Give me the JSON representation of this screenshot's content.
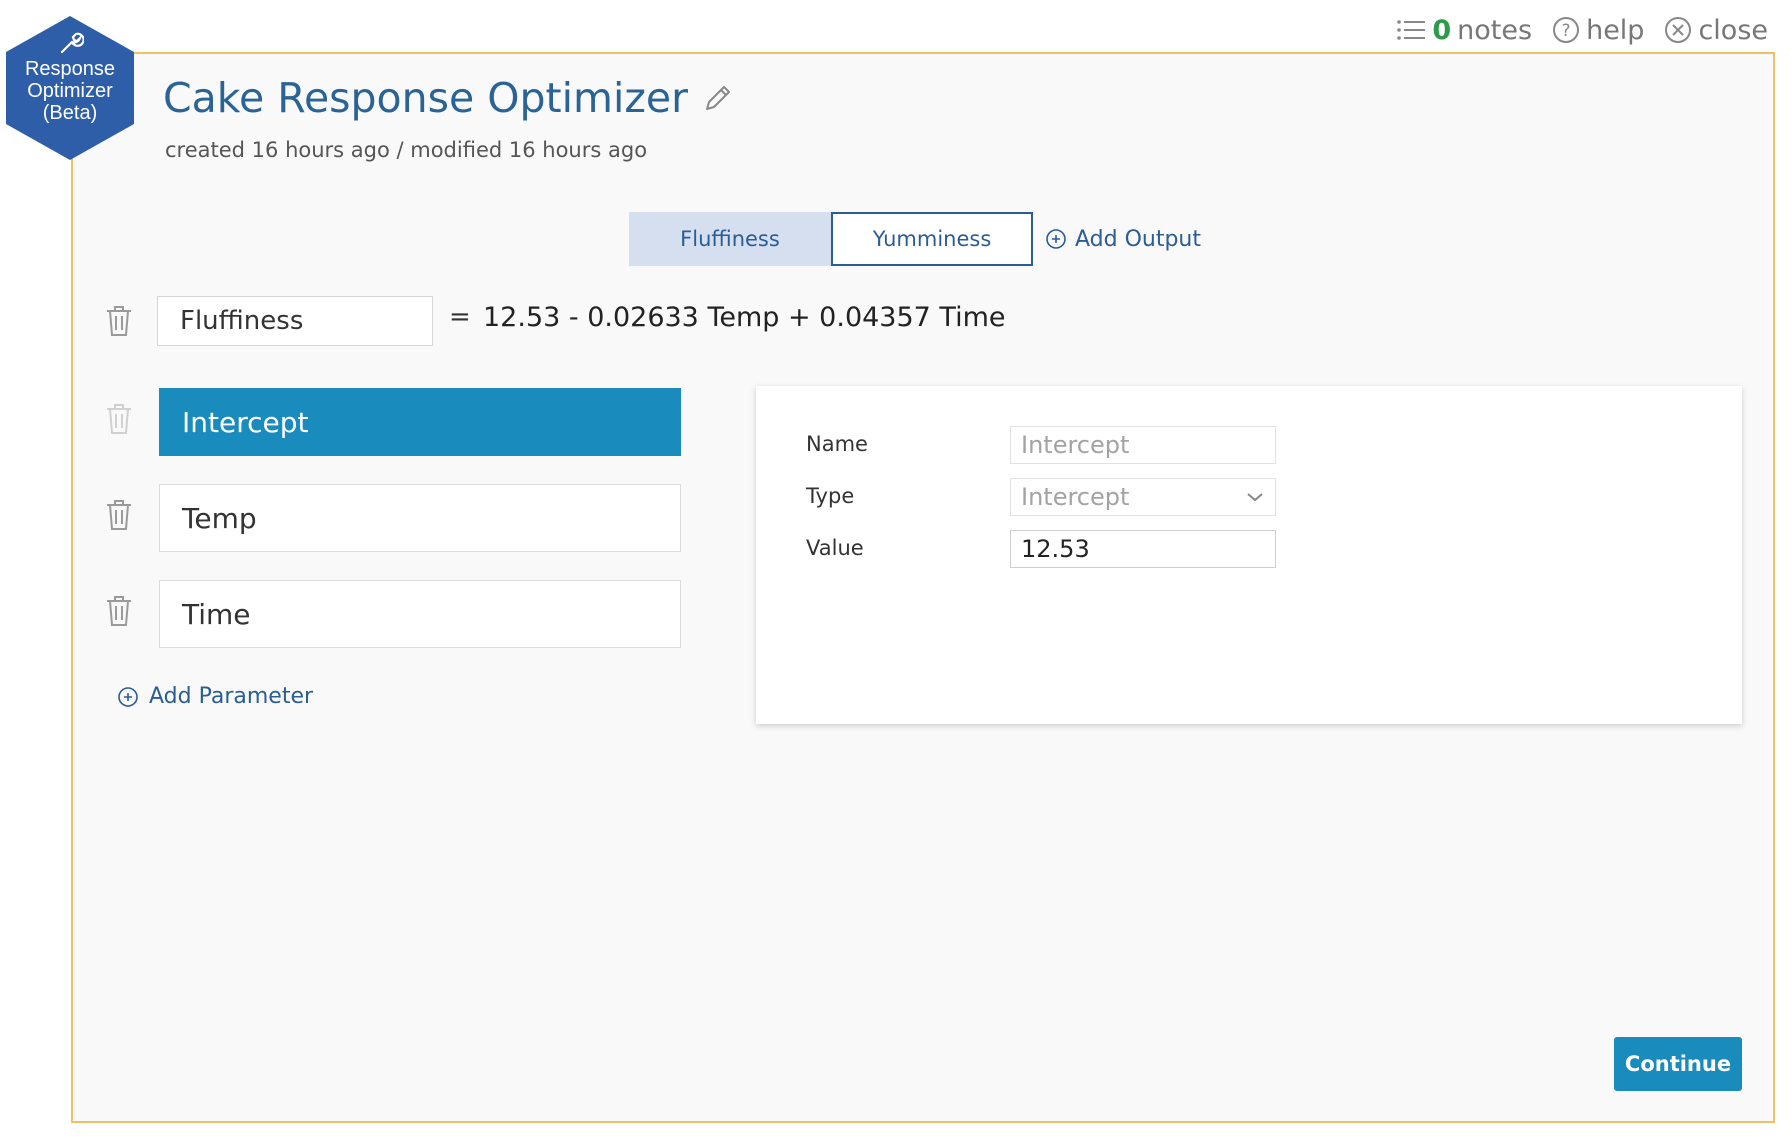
{
  "topbar": {
    "notes_count": "0",
    "notes_label": "notes",
    "help_label": "help",
    "close_label": "close"
  },
  "logo": {
    "line1": "Response",
    "line2": "Optimizer",
    "line3": "(Beta)"
  },
  "header": {
    "title": "Cake Response Optimizer",
    "subtitle": "created 16 hours ago / modified 16 hours ago"
  },
  "outputs": {
    "tabs": [
      {
        "label": "Fluffiness",
        "active": true
      },
      {
        "label": "Yumminess",
        "active": false
      }
    ],
    "add_output_label": "Add Output"
  },
  "output": {
    "name": "Fluffiness",
    "equals": "=",
    "equation": "12.53 - 0.02633 Temp + 0.04357 Time"
  },
  "parameters": {
    "items": [
      {
        "label": "Intercept",
        "selected": true
      },
      {
        "label": "Temp",
        "selected": false
      },
      {
        "label": "Time",
        "selected": false
      }
    ],
    "add_parameter_label": "Add Parameter"
  },
  "detail": {
    "name_label": "Name",
    "name_value": "Intercept",
    "type_label": "Type",
    "type_value": "Intercept",
    "value_label": "Value",
    "value_value": "12.53"
  },
  "actions": {
    "continue_label": "Continue"
  },
  "colors": {
    "frame_border": "#f0c067",
    "accent_blue": "#1a8bbd",
    "link_blue": "#2a5d94",
    "title_blue": "#2a6496",
    "logo_blue": "#2e5ea8",
    "notes_green": "#2e9a4a"
  },
  "icons": {
    "notes": "list-icon",
    "help": "question-circle-icon",
    "close": "x-circle-icon",
    "edit": "pencil-icon",
    "delete": "trash-icon",
    "add": "plus-circle-icon",
    "logo": "wrench-icon",
    "dropdown": "chevron-down-icon"
  }
}
